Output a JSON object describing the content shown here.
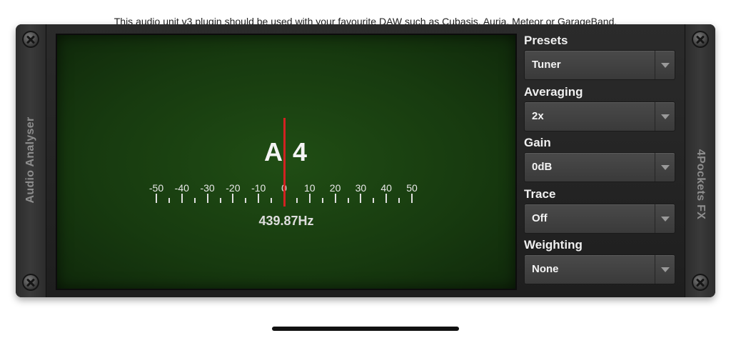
{
  "header": {
    "note": "This audio unit v3 plugin should be used with your favourite DAW such as Cubasis, Auria, Meteor or GarageBand."
  },
  "plugin": {
    "left_label": "Audio Analyser",
    "right_label": "4Pockets FX"
  },
  "tuner": {
    "note": "A4",
    "frequency": "439.87Hz",
    "cents_offset": 0,
    "scale": [
      "-50",
      "-40",
      "-30",
      "-20",
      "-10",
      "0",
      "10",
      "20",
      "30",
      "40",
      "50"
    ]
  },
  "controls": [
    {
      "label": "Presets",
      "value": "Tuner"
    },
    {
      "label": "Averaging",
      "value": "2x"
    },
    {
      "label": "Gain",
      "value": "0dB"
    },
    {
      "label": "Trace",
      "value": "Off"
    },
    {
      "label": "Weighting",
      "value": "None"
    }
  ],
  "colors": {
    "display_bg": "#1b3f12",
    "needle": "#d22222",
    "panel": "#2a2a2a"
  },
  "icons": {
    "screw": "screw-icon",
    "dropdown": "chevron-down-icon"
  }
}
